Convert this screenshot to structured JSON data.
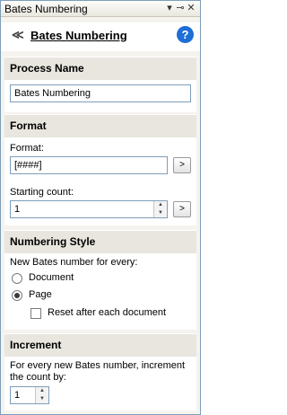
{
  "panel": {
    "title": "Bates Numbering"
  },
  "header": {
    "title": "Bates Numbering"
  },
  "process_name": {
    "section_title": "Process Name",
    "value": "Bates Numbering"
  },
  "format": {
    "section_title": "Format",
    "format_label": "Format:",
    "format_value": "[####]",
    "format_button": ">",
    "starting_count_label": "Starting count:",
    "starting_count_value": "1",
    "starting_count_button": ">"
  },
  "numbering_style": {
    "section_title": "Numbering Style",
    "prompt": "New Bates number for every:",
    "options": [
      {
        "label": "Document",
        "selected": false
      },
      {
        "label": "Page",
        "selected": true
      }
    ],
    "reset_label": "Reset after each document",
    "reset_checked": false
  },
  "increment": {
    "section_title": "Increment",
    "description_line1": "For every new Bates number, increment",
    "description_line2": "the count by:",
    "value": "1"
  }
}
